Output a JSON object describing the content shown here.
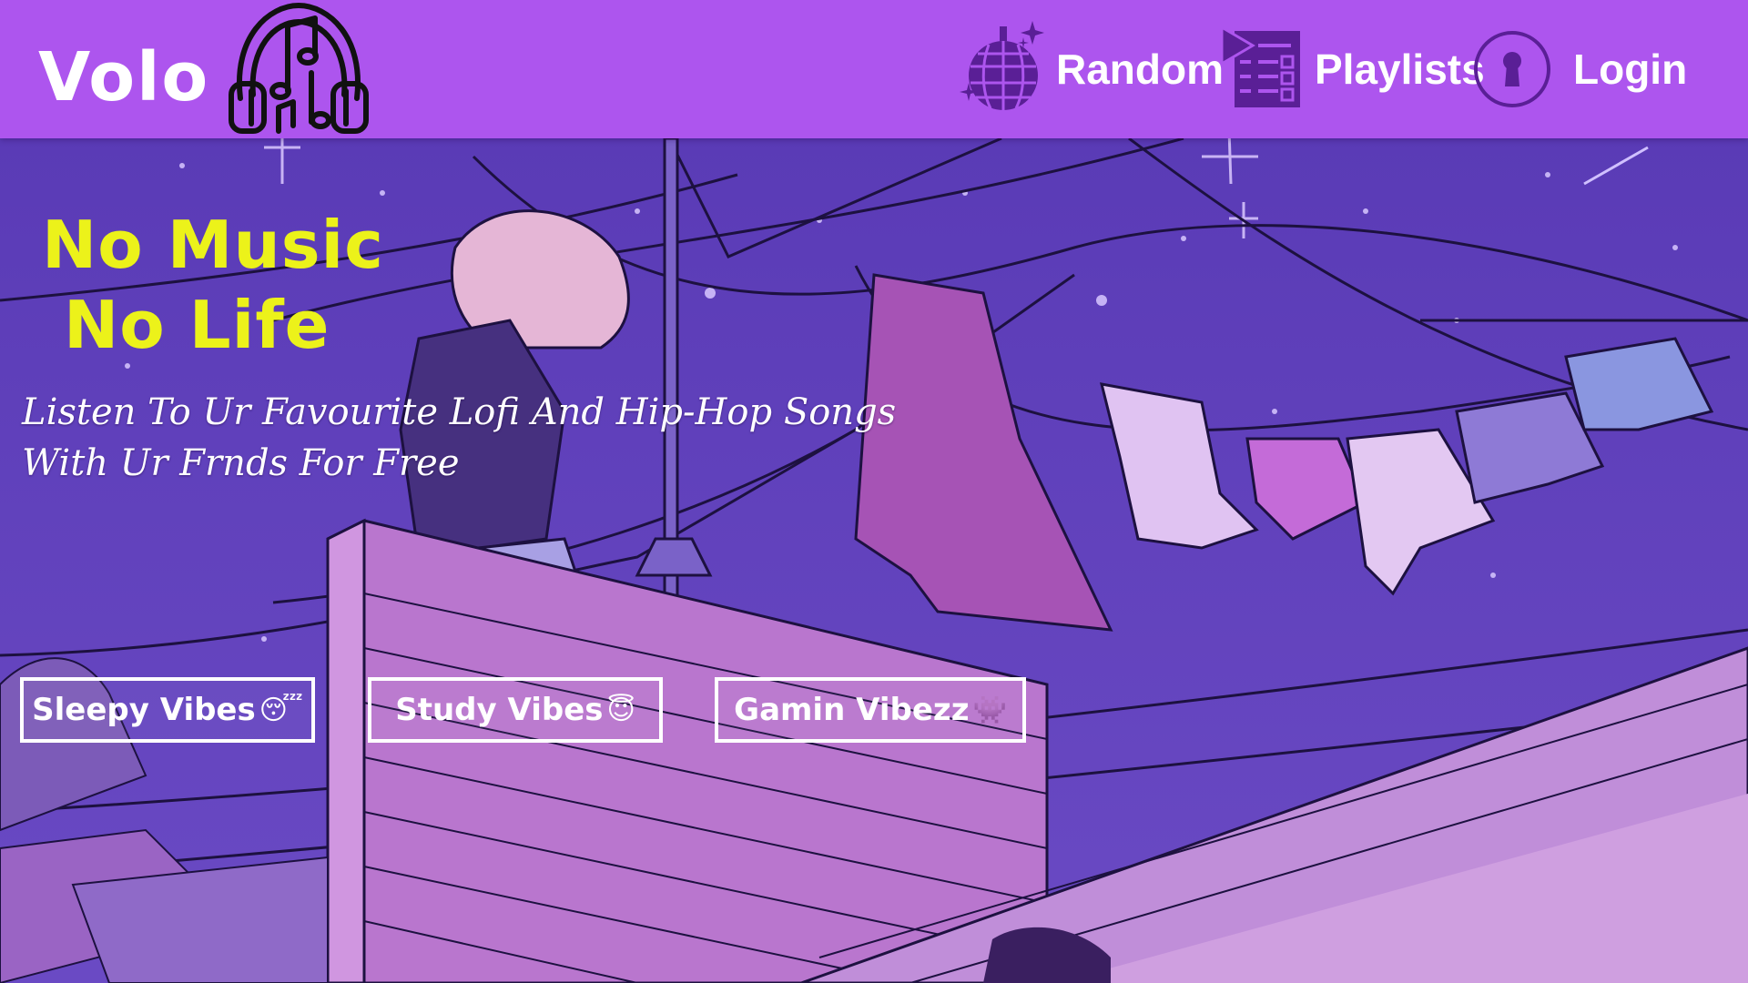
{
  "navbar": {
    "brand": "Volo",
    "logo_icon": "headphones-music-icon",
    "links": [
      {
        "label": "Random",
        "icon": "disco-ball-icon"
      },
      {
        "label": "Playlists",
        "icon": "playlist-icon"
      },
      {
        "label": "Login",
        "icon": "keyhole-icon"
      }
    ]
  },
  "hero": {
    "tagline": [
      "No Music",
      "No Life"
    ],
    "subtitle": [
      "Listen To Ur Favourite Lofi And Hip-Hop Songs",
      "With Ur Frnds For Free"
    ],
    "buttons": [
      {
        "label": "Sleepy Vibes",
        "emoji": "😴"
      },
      {
        "label": "Study Vibes",
        "emoji": "😇"
      },
      {
        "label": "Gamin Vibezz",
        "emoji": "👾"
      }
    ]
  },
  "colors": {
    "navbar_bg": "#ad55ee",
    "tagline": "#ecf21a",
    "text": "#ffffff",
    "sky": "#5b3db8"
  }
}
